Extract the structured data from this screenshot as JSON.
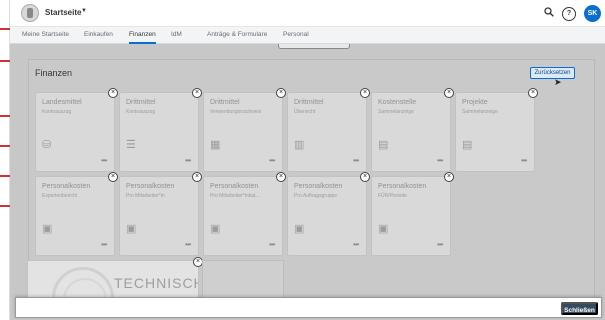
{
  "shellbar": {
    "title": "Startseite",
    "help_label": "?",
    "avatar_initials": "SK"
  },
  "tabs": [
    {
      "label": "Meine Startseite",
      "active": false
    },
    {
      "label": "Einkaufen",
      "active": false
    },
    {
      "label": "Finanzen",
      "active": true
    },
    {
      "label": "IdM",
      "active": false
    },
    {
      "label": "Anträge & Formulare",
      "active": false
    },
    {
      "label": "Personal",
      "active": false
    }
  ],
  "panel": {
    "title": "Finanzen",
    "reset_label": "Zurücksetzen"
  },
  "tiles": [
    {
      "title": "Landesmittel",
      "subtitle": "Kontoauszug",
      "icon": "piggy-bank-icon",
      "glyph": "⛁"
    },
    {
      "title": "Drittmittel",
      "subtitle": "Kontoauszug",
      "icon": "list-icon",
      "glyph": "☰"
    },
    {
      "title": "Drittmittel",
      "subtitle": "Verwendungsnachweis",
      "icon": "calculator-icon",
      "glyph": "▦"
    },
    {
      "title": "Drittmittel",
      "subtitle": "Übersicht",
      "icon": "bar-chart-icon",
      "glyph": "▥"
    },
    {
      "title": "Kostenstelle",
      "subtitle": "Sammelanzeige",
      "icon": "buildings-icon",
      "glyph": "▤"
    },
    {
      "title": "Projekte",
      "subtitle": "Sammelanzeige",
      "icon": "buildings-icon",
      "glyph": "▤"
    },
    {
      "title": "Personalkosten",
      "subtitle": "Expertenbericht",
      "icon": "person-card-icon",
      "glyph": "▣"
    },
    {
      "title": "Personalkosten",
      "subtitle": "Pro Mitarbeiter*in",
      "icon": "person-card-icon",
      "glyph": "▣"
    },
    {
      "title": "Personalkosten",
      "subtitle": "Pro Mitarbeiter*inkat...",
      "icon": "person-card-icon",
      "glyph": "▣"
    },
    {
      "title": "Personalkosten",
      "subtitle": "Pro Auftragsgruppe",
      "icon": "person-card-icon",
      "glyph": "▣"
    },
    {
      "title": "Personalkosten",
      "subtitle": "FÜR/Periode",
      "icon": "person-card-icon",
      "glyph": "▣"
    }
  ],
  "tile_more_label": "•••",
  "tile_close_label": "×",
  "news_tile": {
    "text": "TECHNISCH"
  },
  "footer": {
    "close_label": "Schließen"
  }
}
